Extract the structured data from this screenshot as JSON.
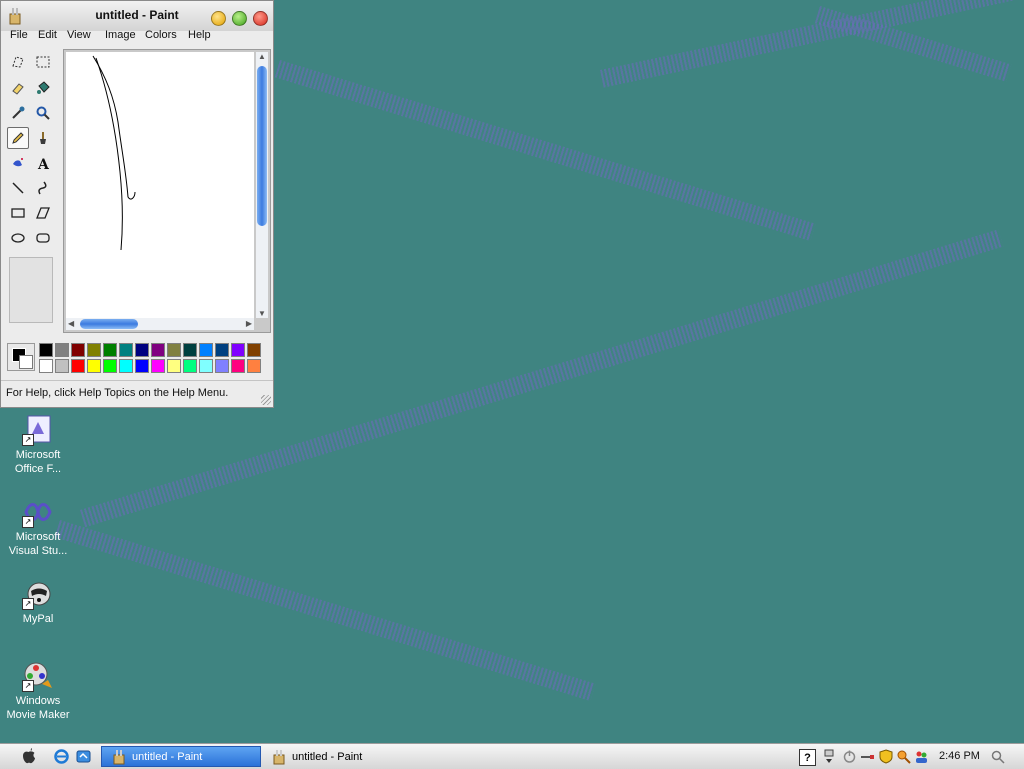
{
  "window": {
    "title": "untitled - Paint",
    "menus": [
      "File",
      "Edit",
      "View",
      "Image",
      "Colors",
      "Help"
    ],
    "status_text": "For Help, click Help Topics on the Help Menu."
  },
  "tools": [
    "free-select-icon",
    "rect-select-icon",
    "eraser-icon",
    "fill-icon",
    "color-picker-icon",
    "magnifier-icon",
    "pencil-icon",
    "brush-icon",
    "airbrush-icon",
    "text-icon",
    "line-icon",
    "curve-icon",
    "rectangle-icon",
    "polygon-icon",
    "ellipse-icon",
    "rounded-rect-icon"
  ],
  "selected_tool": "pencil-icon",
  "palette": {
    "foreground": "#000000",
    "background": "#ffffff",
    "row1": [
      "#000000",
      "#808080",
      "#800000",
      "#808000",
      "#008000",
      "#008080",
      "#000080",
      "#800080",
      "#808040",
      "#004040",
      "#0080ff",
      "#004080",
      "#8000ff",
      "#804000"
    ],
    "row2": [
      "#ffffff",
      "#c0c0c0",
      "#ff0000",
      "#ffff00",
      "#00ff00",
      "#00ffff",
      "#0000ff",
      "#ff00ff",
      "#ffff80",
      "#00ff80",
      "#80ffff",
      "#8080ff",
      "#ff0080",
      "#ff8040"
    ]
  },
  "desktop_icons": [
    {
      "line1": "Microsoft",
      "line2": "Office F...",
      "icon": "office-icon"
    },
    {
      "line1": "Microsoft",
      "line2": "Visual Stu...",
      "icon": "visual-studio-icon"
    },
    {
      "line1": "MyPal",
      "line2": "",
      "icon": "mypal-icon"
    },
    {
      "line1": "Windows",
      "line2": "Movie Maker",
      "icon": "movie-maker-icon"
    }
  ],
  "taskbar": {
    "tasks": [
      {
        "label": "untitled - Paint",
        "active": true
      },
      {
        "label": "untitled - Paint",
        "active": false
      }
    ],
    "clock": "2:46 PM",
    "tray_help": "?"
  }
}
